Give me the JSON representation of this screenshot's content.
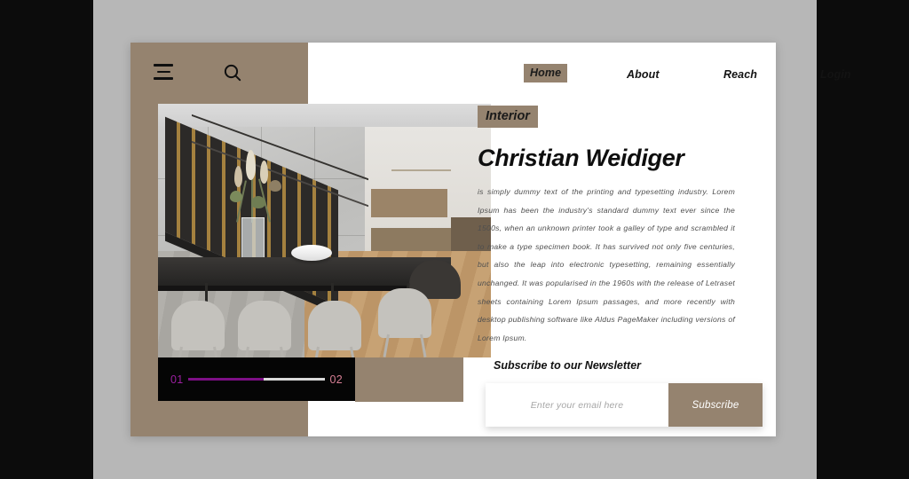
{
  "frame": {
    "outer_bar_color": "#0c0c0c",
    "canvas_color": "#b7b7b7",
    "card_color": "#ffffff",
    "accent_tan": "#95836f"
  },
  "header": {
    "menu_icon": "hamburger-menu-icon",
    "search_icon": "search-icon"
  },
  "nav": {
    "items": [
      {
        "label": "Home",
        "active": true
      },
      {
        "label": "About",
        "active": false
      },
      {
        "label": "Reach",
        "active": false
      },
      {
        "label": "Login",
        "active": false
      }
    ]
  },
  "hero": {
    "photo_alt": "interior-dining-room-photo",
    "slider": {
      "current": "01",
      "total": "02",
      "progress_percent": 55,
      "fill_color": "#7d0f86",
      "track_color": "#d9d9d9",
      "current_color": "#9b1fa0",
      "total_color": "#d77f95"
    }
  },
  "content": {
    "badge": "Interior",
    "title": "Christian Weidiger",
    "body": "is simply dummy text of the printing and typesetting industry. Lorem Ipsum has been the industry's standard dummy text ever since the 1500s, when an unknown printer took a galley of type and scrambled it to make a type specimen book. It has survived not only five centuries, but also the leap into electronic typesetting, remaining essentially unchanged. It was popularised in the 1960s with the release of Letraset sheets containing Lorem Ipsum passages, and more recently with desktop publishing software like Aldus PageMaker including versions of Lorem Ipsum.",
    "newsletter": {
      "heading": "Subscribe to our Newsletter",
      "email_placeholder": "Enter your email here",
      "email_value": "",
      "button_label": "Subscribe"
    }
  }
}
